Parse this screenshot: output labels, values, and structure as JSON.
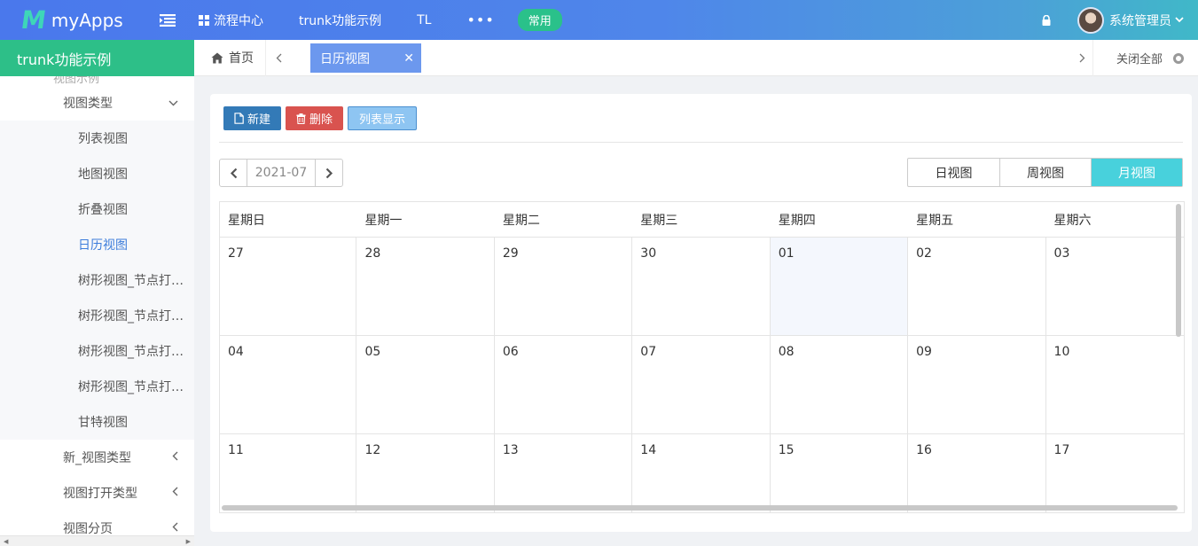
{
  "app": {
    "logo_mark": "M",
    "name": "myApps"
  },
  "topnav": {
    "items": [
      {
        "label": "流程中心",
        "icon": "grid-icon"
      },
      {
        "label": "trunk功能示例"
      },
      {
        "label": "TL"
      },
      {
        "label": "•••"
      }
    ],
    "pill_label": "常用"
  },
  "user": {
    "name": "系统管理员",
    "avatar": "user-avatar"
  },
  "sidebar": {
    "title": "trunk功能示例",
    "clipped_label": "视图示例",
    "items": [
      {
        "label": "视图类型",
        "level": 2,
        "chevron": "down"
      },
      {
        "label": "列表视图",
        "level": 3
      },
      {
        "label": "地图视图",
        "level": 3
      },
      {
        "label": "折叠视图",
        "level": 3
      },
      {
        "label": "日历视图",
        "level": 3,
        "active": true
      },
      {
        "label": "树形视图_节点打开...",
        "level": 3
      },
      {
        "label": "树形视图_节点打开...",
        "level": 3
      },
      {
        "label": "树形视图_节点打开...",
        "level": 3
      },
      {
        "label": "树形视图_节点打开...",
        "level": 3
      },
      {
        "label": "甘特视图",
        "level": 3
      },
      {
        "label": "新_视图类型",
        "level": 2,
        "chevron": "left"
      },
      {
        "label": "视图打开类型",
        "level": 2,
        "chevron": "left"
      },
      {
        "label": "视图分页",
        "level": 2,
        "chevron": "left"
      }
    ]
  },
  "tabs": {
    "home_label": "首页",
    "active_label": "日历视图",
    "close_all_label": "关闭全部"
  },
  "toolbar": {
    "new_label": "新建",
    "delete_label": "删除",
    "list_label": "列表显示"
  },
  "calendar": {
    "month_label": "2021-07",
    "views": [
      "日视图",
      "周视图",
      "月视图"
    ],
    "active_view": "月视图",
    "weekdays": [
      "星期日",
      "星期一",
      "星期二",
      "星期三",
      "星期四",
      "星期五",
      "星期六"
    ],
    "weeks": [
      [
        "27",
        "28",
        "29",
        "30",
        "01",
        "02",
        "03"
      ],
      [
        "04",
        "05",
        "06",
        "07",
        "08",
        "09",
        "10"
      ],
      [
        "11",
        "12",
        "13",
        "14",
        "15",
        "16",
        "17"
      ]
    ],
    "highlighted_date": "01"
  },
  "colors": {
    "topbar_start": "#4a78ec",
    "topbar_end": "#40b8c8",
    "sidebar_title": "#2dbf88",
    "active_tab": "#6c98ee",
    "btn_new": "#337ab7",
    "btn_delete": "#d9534f",
    "btn_list": "#8ec5f2",
    "view_active": "#48d1dc",
    "pill": "#2ac18a"
  }
}
